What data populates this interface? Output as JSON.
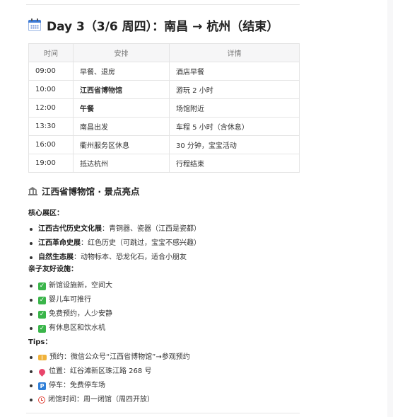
{
  "day": {
    "title": "Day 3（3/6 周四）：南昌 → 杭州（结束）",
    "icon": "calendar-icon"
  },
  "schedule": {
    "headers": [
      "时间",
      "安排",
      "详情"
    ],
    "rows": [
      {
        "time": "09:00",
        "plan": "早餐、退房",
        "detail": "酒店早餐",
        "bold": false
      },
      {
        "time": "10:00",
        "plan": "江西省博物馆",
        "detail": "游玩 2 小时",
        "bold": true
      },
      {
        "time": "12:00",
        "plan": "午餐",
        "detail": "场馆附近",
        "bold": true
      },
      {
        "time": "13:30",
        "plan": "南昌出发",
        "detail": "车程 5 小时（含休息）",
        "bold": false
      },
      {
        "time": "16:00",
        "plan": "衢州服务区休息",
        "detail": "30 分钟，宝宝活动",
        "bold": false
      },
      {
        "time": "19:00",
        "plan": "抵达杭州",
        "detail": "行程结束",
        "bold": false
      }
    ]
  },
  "museum": {
    "title": "江西省博物馆 · 景点亮点",
    "icon": "museum-icon",
    "core_label": "核心展区：",
    "core": [
      {
        "name": "江西古代历史文化展",
        "desc": "：青铜器、瓷器（江西是瓷都）"
      },
      {
        "name": "江西革命史展",
        "desc": "：红色历史（可跳过，宝宝不感兴趣）"
      },
      {
        "name": "自然生态展",
        "desc": "：动物标本、恐龙化石，适合小朋友"
      }
    ],
    "family_label": "亲子友好设施：",
    "family": [
      "新馆设施新，空间大",
      "婴儿车可推行",
      "免费预约，人少安静",
      "有休息区和饮水机"
    ],
    "tips_label": "Tips：",
    "tips": [
      {
        "icon": "ticket-icon",
        "text": "预约：微信公众号“江西省博物馆”→参观预约"
      },
      {
        "icon": "pin-icon",
        "text": "位置：红谷滩新区珠江路 268 号"
      },
      {
        "icon": "parking-icon",
        "text": "停车：免费停车场"
      },
      {
        "icon": "alarm-clock-icon",
        "text": "闭馆时间：周一闭馆（周四开放）"
      }
    ]
  },
  "colors": {
    "check": "#3ab54a",
    "parking": "#2f7fd8",
    "pin": "#e8456b",
    "ticket": "#f0b23a",
    "clock": "#e0453a"
  }
}
